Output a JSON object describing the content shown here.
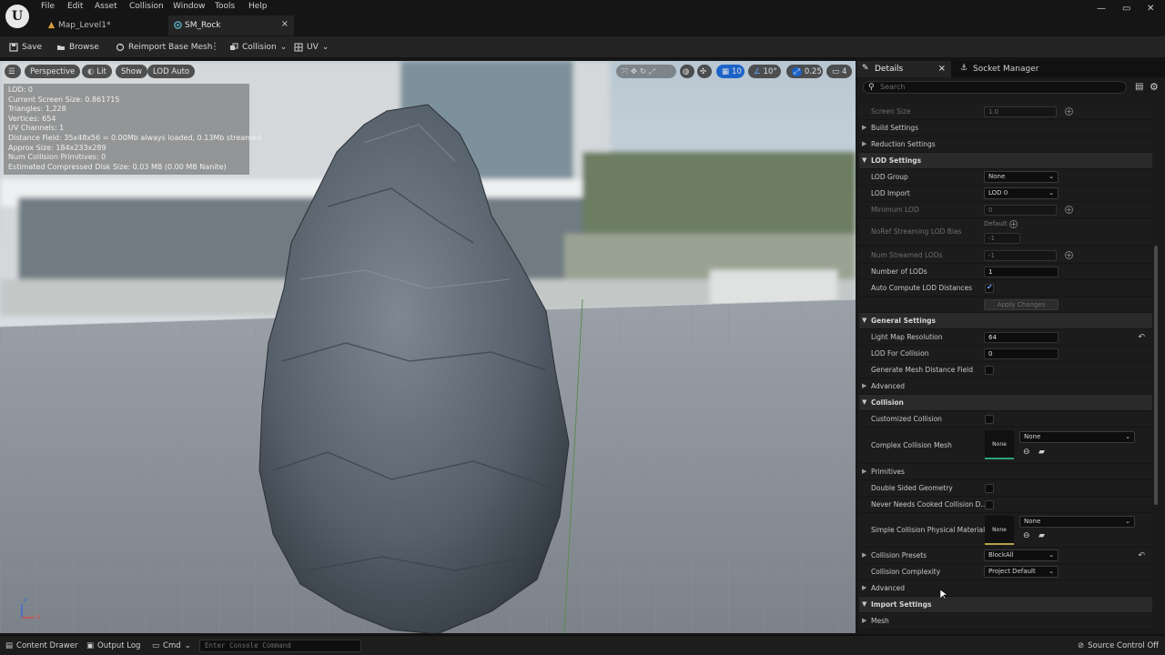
{
  "colors": {
    "accent_blue": "#1c63c9",
    "panel_bg": "#1a1a1a",
    "category_bg": "#2a2a2a",
    "thumb_green": "#2aa27b",
    "thumb_gold": "#b8a14b"
  },
  "menubar": {
    "items": [
      "File",
      "Edit",
      "Asset",
      "Collision",
      "Window",
      "Tools",
      "Help"
    ],
    "tabs": [
      {
        "label": "Map_Level1*",
        "icon": "level-icon"
      },
      {
        "label": "SM_Rock",
        "icon": "static-mesh-icon"
      }
    ],
    "close_glyph": "×",
    "window_controls": [
      "—",
      "▭",
      "✕"
    ]
  },
  "toolbar": {
    "save": "Save",
    "browse": "Browse",
    "reimport": "Reimport Base Mesh",
    "collision": "Collision",
    "uv": "UV"
  },
  "viewport": {
    "perspective": "Perspective",
    "lit": "Lit",
    "show": "Show",
    "lod_auto": "LOD Auto",
    "grid_snap": "10",
    "rotate_snap": "10°",
    "scale_snap": "0.25",
    "camera_speed": "4",
    "stats": [
      "LOD:  0",
      "Current Screen Size:  0.861715",
      "Triangles:  1,228",
      "Vertices:  654",
      "UV Channels:  1",
      "Distance Field:  35x48x56 = 0.00Mb always loaded, 0.13Mb streamed",
      "Approx Size: 184x233x289",
      "Num Collision Primitives:  0",
      "Estimated Compressed Disk Size: 0.03 MB (0.00 MB Nanite)"
    ],
    "axis_x": "x",
    "axis_z": "z"
  },
  "details": {
    "tab_details": "Details",
    "tab_socket": "Socket Manager",
    "close_glyph": "×",
    "search_placeholder": "Search",
    "screen_size_label": "Screen Size",
    "screen_size_value": "1.0",
    "build_settings": "Build Settings",
    "reduction_settings": "Reduction Settings",
    "lod_settings": "LOD Settings",
    "lod_group_label": "LOD Group",
    "lod_group_value": "None",
    "lod_import_label": "LOD Import",
    "lod_import_value": "LOD 0",
    "minimum_lod_label": "Minimum LOD",
    "minimum_lod_value": "0",
    "noref_label": "NoRef Streaming LOD Bias",
    "noref_default": "Default",
    "noref_value": "-1",
    "num_streamed_label": "Num Streamed LODs",
    "num_streamed_value": "-1",
    "number_of_lods_label": "Number of LODs",
    "number_of_lods_value": "1",
    "auto_compute_label": "Auto Compute LOD Distances",
    "auto_compute_checked": true,
    "apply_changes": "Apply Changes",
    "general_settings": "General Settings",
    "light_map_label": "Light Map Resolution",
    "light_map_value": "64",
    "lod_collision_label": "LOD For Collision",
    "lod_collision_value": "0",
    "gen_distance_label": "Generate Mesh Distance Field",
    "advanced_1": "Advanced",
    "collision": "Collision",
    "customized_collision_label": "Customized Collision",
    "complex_mesh_label": "Complex Collision Mesh",
    "complex_mesh_thumb": "None",
    "complex_mesh_value": "None",
    "primitives": "Primitives",
    "double_sided_label": "Double Sided Geometry",
    "never_cooked_label": "Never Needs Cooked Collision D...",
    "simple_phys_label": "Simple Collision Physical Material",
    "simple_phys_thumb": "None",
    "simple_phys_value": "None",
    "presets_label": "Collision Presets",
    "presets_value": "BlockAll",
    "complexity_label": "Collision Complexity",
    "complexity_value": "Project Default",
    "advanced_2": "Advanced",
    "import_settings": "Import Settings",
    "mesh": "Mesh"
  },
  "statusbar": {
    "content_drawer": "Content Drawer",
    "output_log": "Output Log",
    "cmd": "Cmd",
    "console_placeholder": "Enter Console Command",
    "source_control": "Source Control Off"
  }
}
